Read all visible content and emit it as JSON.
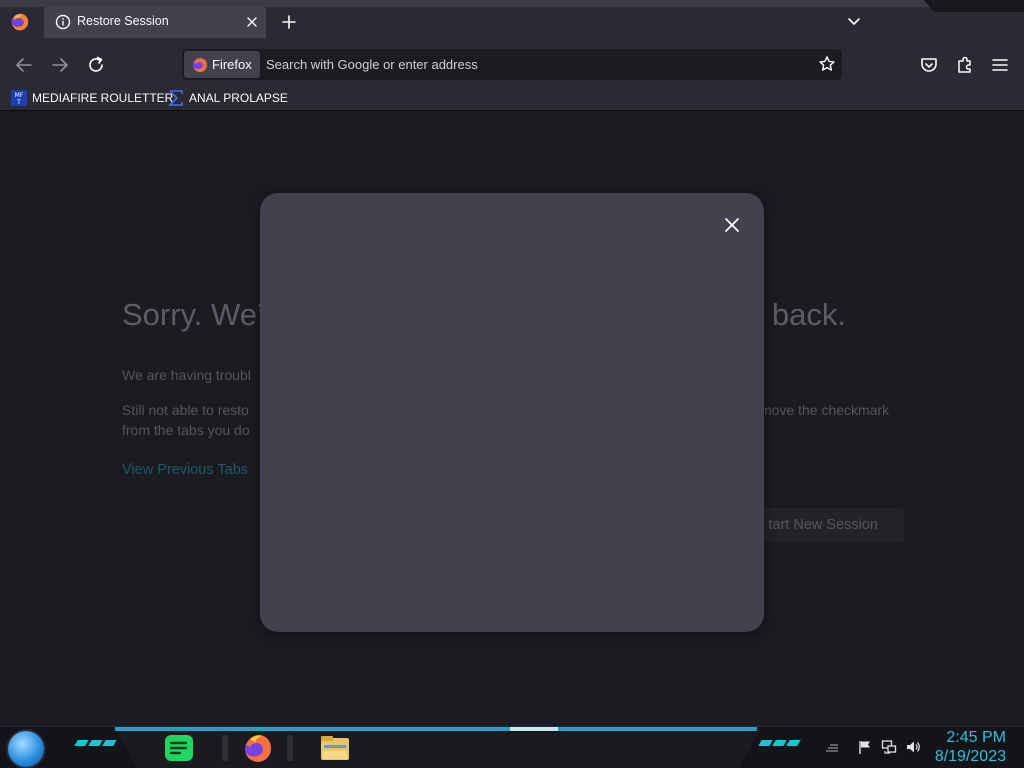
{
  "tab": {
    "title": "Restore Session"
  },
  "navbar": {
    "identity_label": "Firefox",
    "url_placeholder": "Search with Google or enter address"
  },
  "bookmarks": [
    {
      "label": "MEDIAFIRE ROULETTER",
      "icon": "mediafire-icon"
    },
    {
      "label": "ANAL PROLAPSE",
      "icon": "sigma-icon"
    }
  ],
  "page": {
    "title_left": "Sorry. We’",
    "title_right": "back.",
    "p1": "We are having troubl",
    "p2_left": "Still not able to resto",
    "p2_right": "move the checkmark",
    "p3": "from the tabs you do",
    "link": "View Previous Tabs",
    "button": "tart New Session"
  },
  "taskbar": {
    "time": "2:45 PM",
    "date": "8/19/2023"
  },
  "colors": {
    "accent": "#17c6d6",
    "chrome": "#2b2a33",
    "modal": "#42414d"
  }
}
